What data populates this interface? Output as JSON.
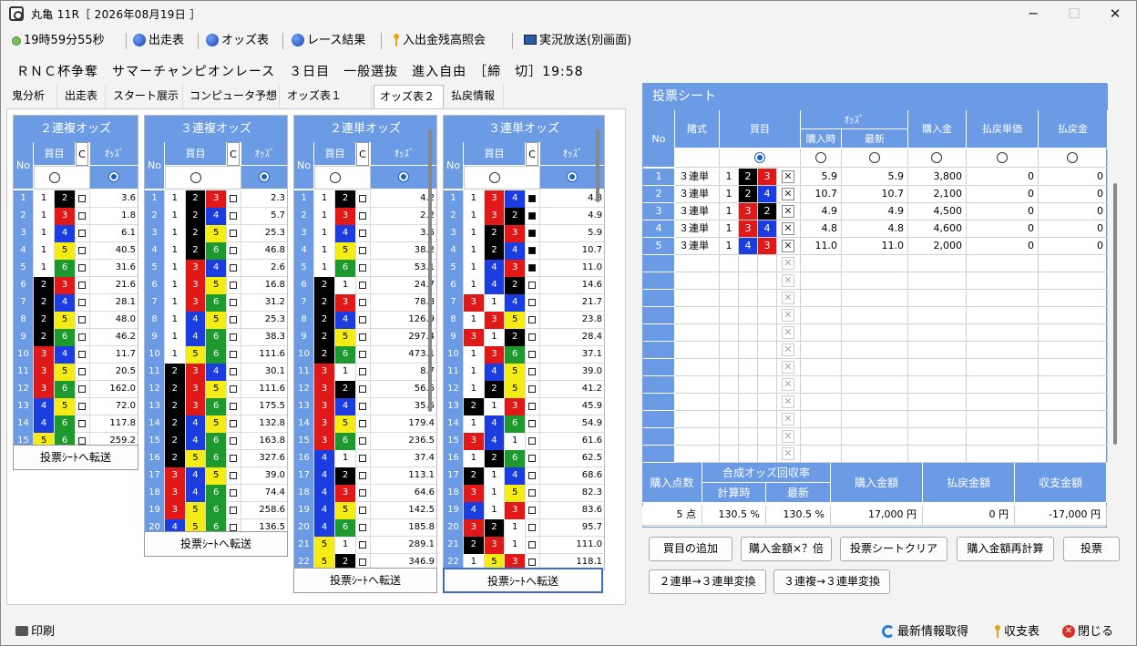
{
  "window": {
    "title": "丸亀 11R［ 2026年08月19日 ］",
    "minimize_icon": "─",
    "maximize_icon": "☐",
    "close_icon": "✕"
  },
  "toolbar": {
    "clock": "19時59分55秒",
    "entry_table": "出走表",
    "odds_table": "オッズ表",
    "race_result": "レース結果",
    "balance": "入出金残高照会",
    "live": "実況放送(別画面)"
  },
  "race_info": "ＲＮＣ杯争奪　サマーチャンピオンレース　３日目　一般選抜　進入自由　［締　切］19:58",
  "tabs": [
    "鬼分析",
    "出走表",
    "スタート展示",
    "コンピュータ予想",
    "オッズ表１",
    "オッズ表２",
    "払戻情報"
  ],
  "active_tab": "オッズ表２",
  "headers": {
    "no": "No",
    "kaime": "買目",
    "c": "C",
    "odds": "ｵｯｽﾞ"
  },
  "send_button": "投票ｼｰﾄへ転送",
  "colors": {
    "1": "#ffffff",
    "2": "#000000",
    "3": "#e01818",
    "4": "#1b3de0",
    "5": "#f6ec15",
    "6": "#1d9a2e",
    "header": "#6b9be5"
  },
  "grids": [
    {
      "title": "２連複オッズ",
      "rows": [
        {
          "no": "1",
          "b": [
            "1",
            "2"
          ],
          "chk": false,
          "odds": "3.6"
        },
        {
          "no": "2",
          "b": [
            "1",
            "3"
          ],
          "chk": false,
          "odds": "1.8"
        },
        {
          "no": "3",
          "b": [
            "1",
            "4"
          ],
          "chk": false,
          "odds": "6.1"
        },
        {
          "no": "4",
          "b": [
            "1",
            "5"
          ],
          "chk": false,
          "odds": "40.5"
        },
        {
          "no": "5",
          "b": [
            "1",
            "6"
          ],
          "chk": false,
          "odds": "31.6"
        },
        {
          "no": "6",
          "b": [
            "2",
            "3"
          ],
          "chk": false,
          "odds": "21.6"
        },
        {
          "no": "7",
          "b": [
            "2",
            "4"
          ],
          "chk": false,
          "odds": "28.1"
        },
        {
          "no": "8",
          "b": [
            "2",
            "5"
          ],
          "chk": false,
          "odds": "48.0"
        },
        {
          "no": "9",
          "b": [
            "2",
            "6"
          ],
          "chk": false,
          "odds": "46.2"
        },
        {
          "no": "10",
          "b": [
            "3",
            "4"
          ],
          "chk": false,
          "odds": "11.7"
        },
        {
          "no": "11",
          "b": [
            "3",
            "5"
          ],
          "chk": false,
          "odds": "20.5"
        },
        {
          "no": "12",
          "b": [
            "3",
            "6"
          ],
          "chk": false,
          "odds": "162.0"
        },
        {
          "no": "13",
          "b": [
            "4",
            "5"
          ],
          "chk": false,
          "odds": "72.0"
        },
        {
          "no": "14",
          "b": [
            "4",
            "6"
          ],
          "chk": false,
          "odds": "117.8"
        },
        {
          "no": "15",
          "b": [
            "5",
            "6"
          ],
          "chk": false,
          "odds": "259.2"
        }
      ]
    },
    {
      "title": "３連複オッズ",
      "rows": [
        {
          "no": "1",
          "b": [
            "1",
            "2",
            "3"
          ],
          "chk": false,
          "odds": "2.3"
        },
        {
          "no": "2",
          "b": [
            "1",
            "2",
            "4"
          ],
          "chk": false,
          "odds": "5.7"
        },
        {
          "no": "3",
          "b": [
            "1",
            "2",
            "5"
          ],
          "chk": false,
          "odds": "25.3"
        },
        {
          "no": "4",
          "b": [
            "1",
            "2",
            "6"
          ],
          "chk": false,
          "odds": "46.8"
        },
        {
          "no": "5",
          "b": [
            "1",
            "3",
            "4"
          ],
          "chk": false,
          "odds": "2.6"
        },
        {
          "no": "6",
          "b": [
            "1",
            "3",
            "5"
          ],
          "chk": false,
          "odds": "16.8"
        },
        {
          "no": "7",
          "b": [
            "1",
            "3",
            "6"
          ],
          "chk": false,
          "odds": "31.2"
        },
        {
          "no": "8",
          "b": [
            "1",
            "4",
            "5"
          ],
          "chk": false,
          "odds": "25.3"
        },
        {
          "no": "9",
          "b": [
            "1",
            "4",
            "6"
          ],
          "chk": false,
          "odds": "38.3"
        },
        {
          "no": "10",
          "b": [
            "1",
            "5",
            "6"
          ],
          "chk": false,
          "odds": "111.6"
        },
        {
          "no": "11",
          "b": [
            "2",
            "3",
            "4"
          ],
          "chk": false,
          "odds": "30.1"
        },
        {
          "no": "12",
          "b": [
            "2",
            "3",
            "5"
          ],
          "chk": false,
          "odds": "111.6"
        },
        {
          "no": "13",
          "b": [
            "2",
            "3",
            "6"
          ],
          "chk": false,
          "odds": "175.5"
        },
        {
          "no": "14",
          "b": [
            "2",
            "4",
            "5"
          ],
          "chk": false,
          "odds": "132.8"
        },
        {
          "no": "15",
          "b": [
            "2",
            "4",
            "6"
          ],
          "chk": false,
          "odds": "163.8"
        },
        {
          "no": "16",
          "b": [
            "2",
            "5",
            "6"
          ],
          "chk": false,
          "odds": "327.6"
        },
        {
          "no": "17",
          "b": [
            "3",
            "4",
            "5"
          ],
          "chk": false,
          "odds": "39.0"
        },
        {
          "no": "18",
          "b": [
            "3",
            "4",
            "6"
          ],
          "chk": false,
          "odds": "74.4"
        },
        {
          "no": "19",
          "b": [
            "3",
            "5",
            "6"
          ],
          "chk": false,
          "odds": "258.6"
        },
        {
          "no": "20",
          "b": [
            "4",
            "5",
            "6"
          ],
          "chk": false,
          "odds": "136.5"
        }
      ]
    },
    {
      "title": "２連単オッズ",
      "rows": [
        {
          "no": "1",
          "b": [
            "1",
            "2"
          ],
          "chk": false,
          "odds": "4.2"
        },
        {
          "no": "2",
          "b": [
            "1",
            "3"
          ],
          "chk": false,
          "odds": "2.2"
        },
        {
          "no": "3",
          "b": [
            "1",
            "4"
          ],
          "chk": false,
          "odds": "3.5"
        },
        {
          "no": "4",
          "b": [
            "1",
            "5"
          ],
          "chk": false,
          "odds": "38.2"
        },
        {
          "no": "5",
          "b": [
            "1",
            "6"
          ],
          "chk": false,
          "odds": "53.1"
        },
        {
          "no": "6",
          "b": [
            "2",
            "1"
          ],
          "chk": false,
          "odds": "24.7"
        },
        {
          "no": "7",
          "b": [
            "2",
            "3"
          ],
          "chk": false,
          "odds": "78.8"
        },
        {
          "no": "8",
          "b": [
            "2",
            "4"
          ],
          "chk": false,
          "odds": "126.9"
        },
        {
          "no": "9",
          "b": [
            "2",
            "5"
          ],
          "chk": false,
          "odds": "297.4"
        },
        {
          "no": "10",
          "b": [
            "2",
            "6"
          ],
          "chk": false,
          "odds": "473.1"
        },
        {
          "no": "11",
          "b": [
            "3",
            "1"
          ],
          "chk": false,
          "odds": "8.7"
        },
        {
          "no": "12",
          "b": [
            "3",
            "2"
          ],
          "chk": false,
          "odds": "56.5"
        },
        {
          "no": "13",
          "b": [
            "3",
            "4"
          ],
          "chk": false,
          "odds": "35.5"
        },
        {
          "no": "14",
          "b": [
            "3",
            "5"
          ],
          "chk": false,
          "odds": "179.4"
        },
        {
          "no": "15",
          "b": [
            "3",
            "6"
          ],
          "chk": false,
          "odds": "236.5"
        },
        {
          "no": "16",
          "b": [
            "4",
            "1"
          ],
          "chk": false,
          "odds": "37.4"
        },
        {
          "no": "17",
          "b": [
            "4",
            "2"
          ],
          "chk": false,
          "odds": "113.1"
        },
        {
          "no": "18",
          "b": [
            "4",
            "3"
          ],
          "chk": false,
          "odds": "64.6"
        },
        {
          "no": "19",
          "b": [
            "4",
            "5"
          ],
          "chk": false,
          "odds": "142.5"
        },
        {
          "no": "20",
          "b": [
            "4",
            "6"
          ],
          "chk": false,
          "odds": "185.8"
        },
        {
          "no": "21",
          "b": [
            "5",
            "1"
          ],
          "chk": false,
          "odds": "289.1"
        },
        {
          "no": "22",
          "b": [
            "5",
            "2"
          ],
          "chk": false,
          "odds": "346.9"
        }
      ]
    },
    {
      "title": "３連単オッズ",
      "rows": [
        {
          "no": "1",
          "b": [
            "1",
            "3",
            "4"
          ],
          "chk": true,
          "odds": "4.8"
        },
        {
          "no": "2",
          "b": [
            "1",
            "3",
            "2"
          ],
          "chk": true,
          "odds": "4.9"
        },
        {
          "no": "3",
          "b": [
            "1",
            "2",
            "3"
          ],
          "chk": true,
          "odds": "5.9"
        },
        {
          "no": "4",
          "b": [
            "1",
            "2",
            "4"
          ],
          "chk": true,
          "odds": "10.7"
        },
        {
          "no": "5",
          "b": [
            "1",
            "4",
            "3"
          ],
          "chk": true,
          "odds": "11.0"
        },
        {
          "no": "6",
          "b": [
            "1",
            "4",
            "2"
          ],
          "chk": false,
          "odds": "14.6"
        },
        {
          "no": "7",
          "b": [
            "3",
            "1",
            "4"
          ],
          "chk": false,
          "odds": "21.7"
        },
        {
          "no": "8",
          "b": [
            "1",
            "3",
            "5"
          ],
          "chk": false,
          "odds": "23.8"
        },
        {
          "no": "9",
          "b": [
            "3",
            "1",
            "2"
          ],
          "chk": false,
          "odds": "28.4"
        },
        {
          "no": "10",
          "b": [
            "1",
            "3",
            "6"
          ],
          "chk": false,
          "odds": "37.1"
        },
        {
          "no": "11",
          "b": [
            "1",
            "4",
            "5"
          ],
          "chk": false,
          "odds": "39.0"
        },
        {
          "no": "12",
          "b": [
            "1",
            "2",
            "5"
          ],
          "chk": false,
          "odds": "41.2"
        },
        {
          "no": "13",
          "b": [
            "2",
            "1",
            "3"
          ],
          "chk": false,
          "odds": "45.9"
        },
        {
          "no": "14",
          "b": [
            "1",
            "4",
            "6"
          ],
          "chk": false,
          "odds": "54.9"
        },
        {
          "no": "15",
          "b": [
            "3",
            "4",
            "1"
          ],
          "chk": false,
          "odds": "61.6"
        },
        {
          "no": "16",
          "b": [
            "1",
            "2",
            "6"
          ],
          "chk": false,
          "odds": "62.5"
        },
        {
          "no": "17",
          "b": [
            "2",
            "1",
            "4"
          ],
          "chk": false,
          "odds": "68.6"
        },
        {
          "no": "18",
          "b": [
            "3",
            "1",
            "5"
          ],
          "chk": false,
          "odds": "82.3"
        },
        {
          "no": "19",
          "b": [
            "4",
            "1",
            "3"
          ],
          "chk": false,
          "odds": "83.6"
        },
        {
          "no": "20",
          "b": [
            "3",
            "2",
            "1"
          ],
          "chk": false,
          "odds": "95.7"
        },
        {
          "no": "21",
          "b": [
            "2",
            "3",
            "1"
          ],
          "chk": false,
          "odds": "111.0"
        },
        {
          "no": "22",
          "b": [
            "1",
            "5",
            "3"
          ],
          "chk": false,
          "odds": "118.1"
        }
      ]
    }
  ],
  "sheet": {
    "title": "投票シート",
    "headers": {
      "no": "No",
      "type": "賭式",
      "kaime": "買目",
      "odds": "ｵｯｽﾞ",
      "odds_at": "購入時",
      "odds_latest": "最新",
      "amount": "購入金",
      "payout_unit": "払戻単価",
      "payout": "払戻金"
    },
    "rows": [
      {
        "no": "1",
        "type": "３連単",
        "b": [
          "1",
          "2",
          "3"
        ],
        "odds_at": "5.9",
        "odds_latest": "5.9",
        "amount": "3,800",
        "payout_unit": "0",
        "payout": "0"
      },
      {
        "no": "2",
        "type": "３連単",
        "b": [
          "1",
          "2",
          "4"
        ],
        "odds_at": "10.7",
        "odds_latest": "10.7",
        "amount": "2,100",
        "payout_unit": "0",
        "payout": "0"
      },
      {
        "no": "3",
        "type": "３連単",
        "b": [
          "1",
          "3",
          "2"
        ],
        "odds_at": "4.9",
        "odds_latest": "4.9",
        "amount": "4,500",
        "payout_unit": "0",
        "payout": "0"
      },
      {
        "no": "4",
        "type": "３連単",
        "b": [
          "1",
          "3",
          "4"
        ],
        "odds_at": "4.8",
        "odds_latest": "4.8",
        "amount": "4,600",
        "payout_unit": "0",
        "payout": "0"
      },
      {
        "no": "5",
        "type": "３連単",
        "b": [
          "1",
          "4",
          "3"
        ],
        "odds_at": "11.0",
        "odds_latest": "11.0",
        "amount": "2,000",
        "payout_unit": "0",
        "payout": "0"
      }
    ],
    "delete_icon": "✕"
  },
  "summary": {
    "h_count": "購入点数",
    "h_rate": "合成オッズ回収率",
    "h_calc": "計算時",
    "h_latest": "最新",
    "h_total": "購入金額",
    "h_payout": "払戻金額",
    "h_balance": "収支金額",
    "count": "5 点",
    "calc": "130.5 %",
    "latest": "130.5 %",
    "total": "17,000 円",
    "payout": "0 円",
    "balance": "-17,000 円"
  },
  "actions": {
    "add": "買目の追加",
    "multiply": "購入金額×？倍",
    "clear": "投票シートクリア",
    "recalc": "購入金額再計算",
    "vote": "投票",
    "conv2": "２連単→３連単変換",
    "conv3": "３連複→３連単変換"
  },
  "statusbar": {
    "print": "印刷",
    "refresh": "最新情報取得",
    "balance": "収支表",
    "close": "閉じる"
  }
}
